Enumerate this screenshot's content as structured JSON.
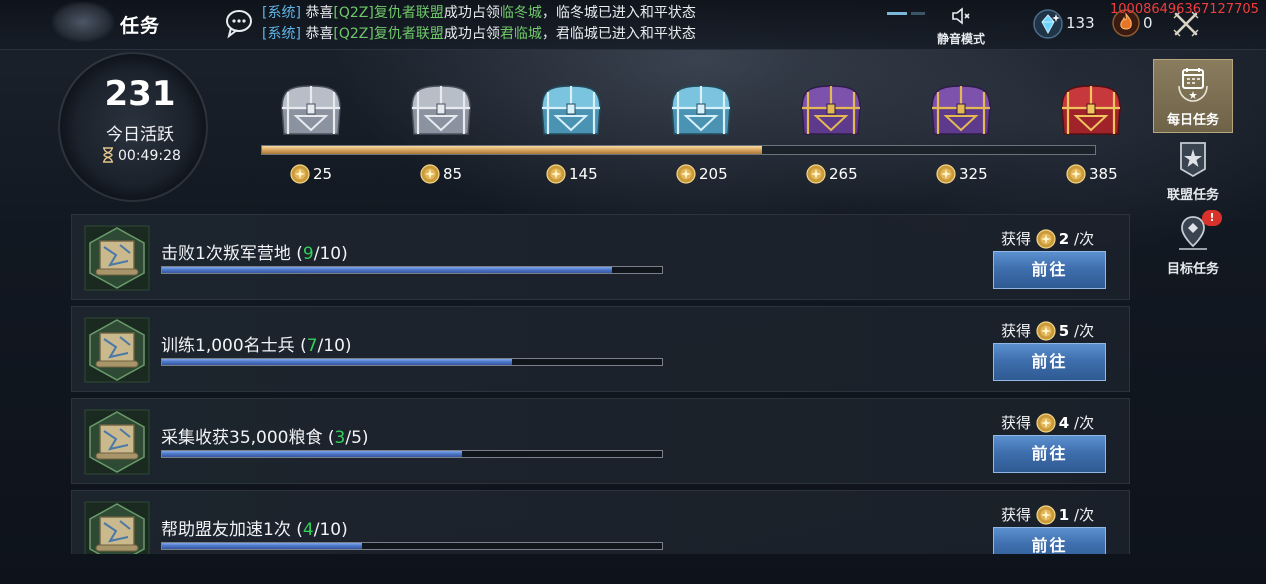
{
  "header": {
    "title": "任务",
    "chat": [
      {
        "tag": "[系统]",
        "pre": " 恭喜",
        "alliance": "[Q2Z]复仇者联盟",
        "mid": "成功占领",
        "city": "临冬城",
        "post": "，临冬城已进入和平状态"
      },
      {
        "tag": "[系统]",
        "pre": " 恭喜",
        "alliance": "[Q2Z]复仇者联盟",
        "mid": "成功占领",
        "city": "君临城",
        "post": "，君临城已进入和平状态"
      }
    ],
    "mute_label": "静音模式",
    "gems": "133",
    "fire": "0",
    "uid": "100086496367127705",
    "colors": {
      "chat_tag": "#5fb4e6",
      "chat_text": "#70c86a",
      "uid": "#f23d3d"
    }
  },
  "activity": {
    "value": "231",
    "label": "今日活跃",
    "timer": "00:49:28",
    "progress": 0.6
  },
  "milestones": [
    {
      "value": "25",
      "chest": "silver"
    },
    {
      "value": "85",
      "chest": "silver"
    },
    {
      "value": "145",
      "chest": "blue"
    },
    {
      "value": "205",
      "chest": "blue"
    },
    {
      "value": "265",
      "chest": "purple"
    },
    {
      "value": "325",
      "chest": "purple"
    },
    {
      "value": "385",
      "chest": "red"
    }
  ],
  "tasks": [
    {
      "title": "击败1次叛军营地",
      "current": "9",
      "total": "10",
      "progress": 0.9,
      "reward_label": "获得",
      "reward": "2",
      "unit": "/次",
      "button": "前往"
    },
    {
      "title": "训练1,000名士兵",
      "current": "7",
      "total": "10",
      "progress": 0.7,
      "reward_label": "获得",
      "reward": "5",
      "unit": "/次",
      "button": "前往"
    },
    {
      "title": "采集收获35,000粮食",
      "current": "3",
      "total": "5",
      "progress": 0.6,
      "reward_label": "获得",
      "reward": "4",
      "unit": "/次",
      "button": "前往"
    },
    {
      "title": "帮助盟友加速1次",
      "current": "4",
      "total": "10",
      "progress": 0.4,
      "reward_label": "获得",
      "reward": "1",
      "unit": "/次",
      "button": "前往"
    }
  ],
  "sidebar": {
    "tabs": [
      {
        "label": "每日任务",
        "active": true
      },
      {
        "label": "联盟任务",
        "active": false
      },
      {
        "label": "目标任务",
        "active": false,
        "badge": "!"
      }
    ]
  }
}
